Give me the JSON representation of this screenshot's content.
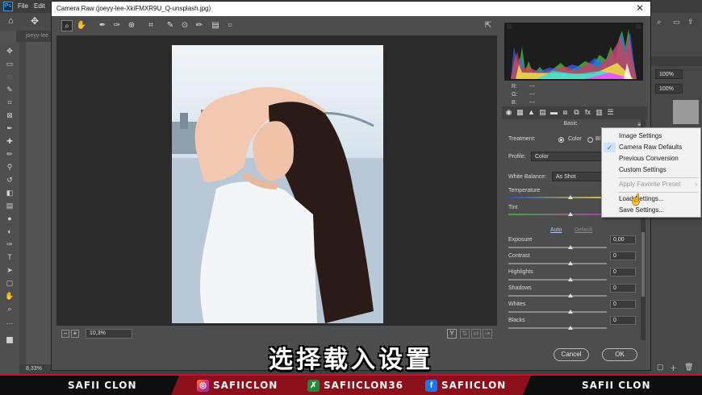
{
  "ps": {
    "menu": [
      "File",
      "Edit"
    ],
    "doc_tab": "joeyy-lee",
    "zoom_status": "8,33%",
    "right_zoom_1": "100%",
    "right_zoom_2": "100%"
  },
  "dialog": {
    "title": "Camera Raw (joeyy-lee-XkiFMXR9U_Q-unsplash.jpg)",
    "zoom": "10,3%"
  },
  "histogram": {
    "r_label": "R:",
    "g_label": "G:",
    "b_label": "B:",
    "r": "---",
    "g": "---",
    "b": "---"
  },
  "panel": {
    "section": "Basic",
    "treatment_label": "Treatment:",
    "treatment_color": "Color",
    "treatment_bw": "Bl",
    "profile_label": "Profile:",
    "profile_value": "Color",
    "wb_label": "White Balance:",
    "wb_value": "As Shot",
    "temperature": "Temperature",
    "tint": "Tint",
    "auto": "Auto",
    "default": "Default",
    "sliders": [
      {
        "label": "Exposure",
        "value": "0,00"
      },
      {
        "label": "Contrast",
        "value": "0"
      },
      {
        "label": "Highlights",
        "value": "0"
      },
      {
        "label": "Shadows",
        "value": "0"
      },
      {
        "label": "Whites",
        "value": "0"
      },
      {
        "label": "Blacks",
        "value": "0"
      }
    ]
  },
  "buttons": {
    "cancel": "Cancel",
    "ok": "OK"
  },
  "menu": {
    "image_settings": "Image Settings",
    "camera_raw_defaults": "Camera Raw Defaults",
    "previous_conversion": "Previous Conversion",
    "custom_settings": "Custom Settings",
    "apply_favorite_preset": "Apply Favorite Preset",
    "load_settings": "Load Settings...",
    "save_settings": "Save Settings..."
  },
  "subtitle": "选择载入设置",
  "social": {
    "left": "SAFII CLON",
    "instagram": "SAFIICLON",
    "other": "SAFIICLON36",
    "facebook": "SAFIICLON",
    "right": "SAFII CLON"
  },
  "colors": {
    "accent_red": "#c8102e",
    "check_blue": "#2a6fc9"
  }
}
